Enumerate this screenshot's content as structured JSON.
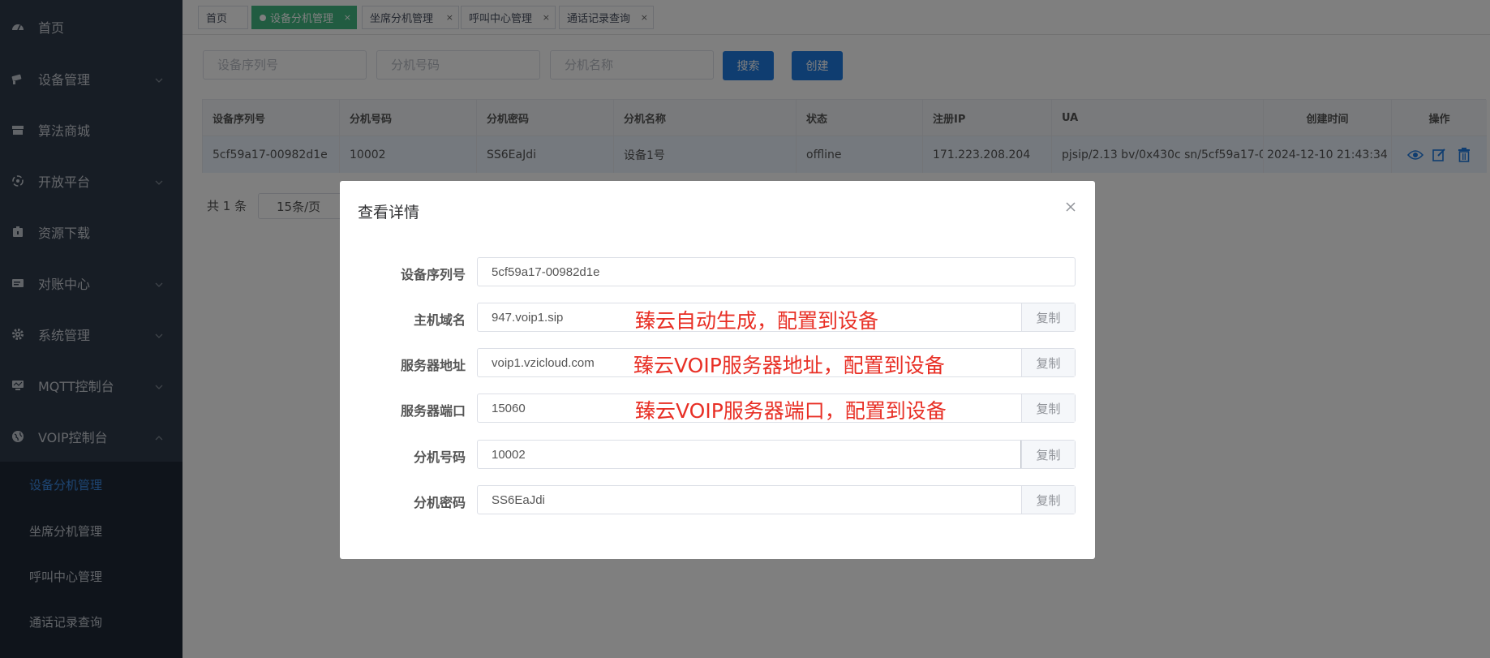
{
  "sidebar": {
    "items": [
      {
        "label": "首页",
        "icon": "dashboard-icon"
      },
      {
        "label": "设备管理",
        "icon": "camera-icon"
      },
      {
        "label": "算法商城",
        "icon": "store-icon"
      },
      {
        "label": "开放平台",
        "icon": "platform-icon"
      },
      {
        "label": "资源下载",
        "icon": "download-icon"
      },
      {
        "label": "对账中心",
        "icon": "ledger-icon"
      },
      {
        "label": "系统管理",
        "icon": "gear-icon"
      },
      {
        "label": "MQTT控制台",
        "icon": "monitor-icon"
      },
      {
        "label": "VOIP控制台",
        "icon": "globe-icon"
      }
    ],
    "submenu": [
      {
        "label": "设备分机管理",
        "active": true
      },
      {
        "label": "坐席分机管理"
      },
      {
        "label": "呼叫中心管理"
      },
      {
        "label": "通话记录查询"
      }
    ]
  },
  "tabs": [
    {
      "label": "首页"
    },
    {
      "label": "设备分机管理",
      "active": true
    },
    {
      "label": "坐席分机管理"
    },
    {
      "label": "呼叫中心管理"
    },
    {
      "label": "通话记录查询"
    }
  ],
  "search": {
    "serial_placeholder": "设备序列号",
    "ext_placeholder": "分机号码",
    "name_placeholder": "分机名称",
    "search_label": "搜索",
    "create_label": "创建"
  },
  "table": {
    "headers": [
      "设备序列号",
      "分机号码",
      "分机密码",
      "分机名称",
      "状态",
      "注册IP",
      "UA",
      "创建时间",
      "操作"
    ],
    "rows": [
      [
        "5cf59a17-00982d1e",
        "10002",
        "SS6EaJdi",
        "设备1号",
        "offline",
        "171.223.208.204",
        "pjsip/2.13 bv/0x430c sn/5cf59a17-00...",
        "2024-12-10 21:43:34"
      ]
    ]
  },
  "pager": {
    "total": "共 1 条",
    "page_size": "15条/页"
  },
  "modal": {
    "title": "查看详情",
    "copy_label": "复制",
    "fields": [
      {
        "label": "设备序列号",
        "value": "5cf59a17-00982d1e"
      },
      {
        "label": "主机域名",
        "value": "947.voip1.sip",
        "note": "臻云自动生成，配置到设备"
      },
      {
        "label": "服务器地址",
        "value": "voip1.vzicloud.com",
        "note": "臻云VOIP服务器地址，配置到设备"
      },
      {
        "label": "服务器端口",
        "value": "15060",
        "note": "臻云VOIP服务器端口，配置到设备"
      },
      {
        "label": "分机号码",
        "value": "10002"
      },
      {
        "label": "分机密码",
        "value": "SS6EaJdi"
      }
    ]
  },
  "colors": {
    "sidebar_bg": "#2f3a4a",
    "accent": "#1f7be0",
    "active_tab": "#42b983",
    "note_red": "#e82f25"
  }
}
